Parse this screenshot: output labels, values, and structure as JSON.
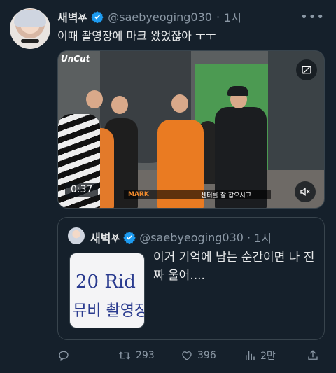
{
  "tweet": {
    "display_name": "새벽⛧",
    "handle": "@saebyeoging030",
    "separator": "·",
    "time": "1시",
    "text": "이때 촬영장에 마크 왔었잖아 ㅜㅜ"
  },
  "video": {
    "watermark": "UnCut",
    "duration": "0:37",
    "subtitle_name": "MARK",
    "subtitle_text": "센터를 잘 잡으시고"
  },
  "quote": {
    "display_name": "새벽⛧",
    "handle": "@saebyeoging030",
    "separator": "·",
    "time": "1시",
    "text": "이거 기억에 남는 순간이면 나 진짜 울어....",
    "image_line1": "20 Rid",
    "image_line2": "뮤비 촬영장"
  },
  "actions": {
    "retweets": "293",
    "likes": "396",
    "views": "2만"
  },
  "colors": {
    "background": "#15202b",
    "text": "#e7e9ea",
    "secondary": "#8b98a5",
    "verified": "#1d9bf0",
    "border": "#38444d"
  },
  "icons": [
    "more-icon",
    "verified-icon",
    "media-settings-icon",
    "mute-icon",
    "reply-icon",
    "retweet-icon",
    "like-icon",
    "views-icon",
    "share-icon"
  ]
}
